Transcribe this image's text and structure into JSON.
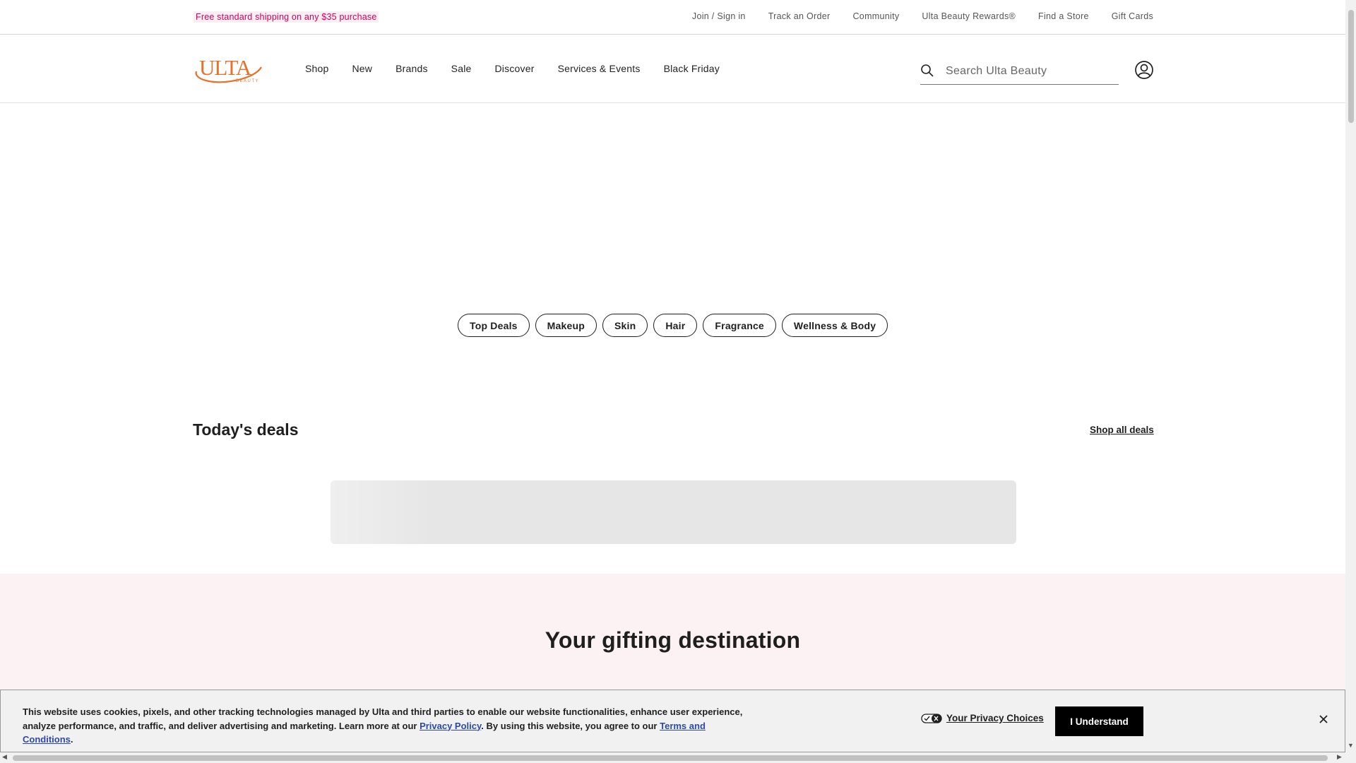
{
  "utility_bar": {
    "promo": "Free standard shipping on any $35 purchase",
    "links": [
      "Join / Sign in",
      "Track an Order",
      "Community",
      "Ulta Beauty Rewards®",
      "Find a Store",
      "Gift Cards"
    ]
  },
  "header": {
    "logo_text": "ULTA",
    "logo_subtext": "BEAUTY",
    "nav": [
      "Shop",
      "New",
      "Brands",
      "Sale",
      "Discover",
      "Services & Events",
      "Black Friday"
    ],
    "search_placeholder": "Search Ulta Beauty"
  },
  "categories": [
    "Top Deals",
    "Makeup",
    "Skin",
    "Hair",
    "Fragrance",
    "Wellness & Body"
  ],
  "deals": {
    "title": "Today's deals",
    "shop_all": "Shop all deals"
  },
  "gifting": {
    "title": "Your gifting destination"
  },
  "cookie_banner": {
    "text_before": "This website uses cookies, pixels, and other tracking technologies managed by Ulta and third parties to enable our website functionalities, enhance user experience, analyze performance, and traffic, and deliver advertising and marketing. Learn more at our ",
    "privacy_link": "Privacy Policy",
    "text_middle": ". By using this website, you agree to our ",
    "terms_link": "Terms and Conditions",
    "text_after": ".",
    "privacy_choices": "Your Privacy Choices",
    "understand": "I Understand"
  },
  "colors": {
    "promo_pink": "#d1005a",
    "brand_orange": "#e8702a",
    "gifting_bg": "#fcf1f3",
    "link_blue": "#2b4aa8"
  }
}
